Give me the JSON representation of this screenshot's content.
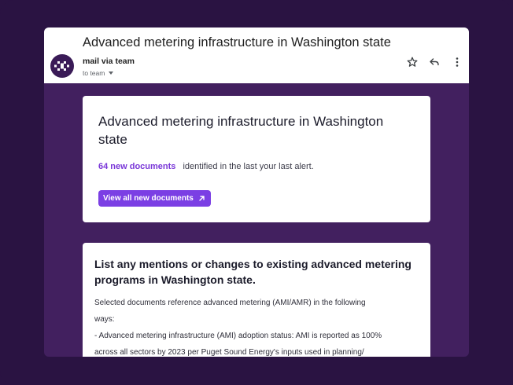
{
  "email": {
    "subject": "Advanced metering infrastructure in Washington state",
    "sender": "mail via team",
    "recipient": "to team",
    "icons": [
      "star-icon",
      "reply-icon",
      "more-vert-icon",
      "chevron-down-icon"
    ]
  },
  "alert_card": {
    "title": "Advanced metering infrastructure in Washington state",
    "count_link": "64 new documents",
    "count_suffix": "identified in the last your last alert.",
    "button_label": "View all new documents",
    "accent_color": "#7b3fe4"
  },
  "summary_card": {
    "question": "List any mentions or changes to existing advanced metering programs in Washington state.",
    "body_lines": [
      "Selected documents reference advanced metering (AMI/AMR) in the following",
      "ways:",
      "- Advanced metering infrastructure (AMI) adoption status: AMI is reported as 100%",
      "across all sectors by 2023 per Puget Sound Energy's inputs used in planning/"
    ]
  },
  "colors": {
    "background": "#2a1342",
    "content_background": "#42205f"
  }
}
